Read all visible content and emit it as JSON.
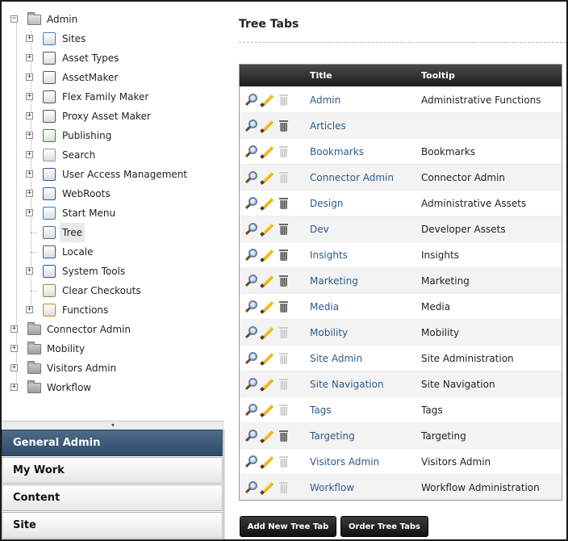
{
  "tree": {
    "root": {
      "label": "Admin",
      "expander": "−"
    },
    "children": [
      {
        "label": "Sites",
        "icon": "sites-icon",
        "expander": "+"
      },
      {
        "label": "Asset Types",
        "icon": "asset-types-icon",
        "expander": "+"
      },
      {
        "label": "AssetMaker",
        "icon": "assetmaker-icon",
        "expander": "+"
      },
      {
        "label": "Flex Family Maker",
        "icon": "flex-family-icon",
        "expander": "+"
      },
      {
        "label": "Proxy Asset Maker",
        "icon": "proxy-asset-icon",
        "expander": "+"
      },
      {
        "label": "Publishing",
        "icon": "publishing-icon",
        "expander": "+"
      },
      {
        "label": "Search",
        "icon": "search-folder-icon",
        "expander": "+"
      },
      {
        "label": "User Access Management",
        "icon": "tools-icon",
        "expander": "+"
      },
      {
        "label": "WebRoots",
        "icon": "tools-icon",
        "expander": "+"
      },
      {
        "label": "Start Menu",
        "icon": "start-menu-icon",
        "expander": "+"
      },
      {
        "label": "Tree",
        "icon": "tree-icon",
        "expander": ""
      },
      {
        "label": "Locale",
        "icon": "tools-icon",
        "expander": ""
      },
      {
        "label": "System Tools",
        "icon": "tools-icon",
        "expander": "+"
      },
      {
        "label": "Clear Checkouts",
        "icon": "checkout-icon",
        "expander": ""
      },
      {
        "label": "Functions",
        "icon": "functions-icon",
        "expander": "+"
      }
    ],
    "top_level": [
      {
        "label": "Connector Admin",
        "expander": "+"
      },
      {
        "label": "Mobility",
        "expander": "+"
      },
      {
        "label": "Visitors Admin",
        "expander": "+"
      },
      {
        "label": "Workflow",
        "expander": "+"
      }
    ]
  },
  "splitter_glyph": "▾",
  "accordion": [
    "General Admin",
    "My Work",
    "Content",
    "Site"
  ],
  "main": {
    "title": "Tree Tabs",
    "columns": {
      "title": "Title",
      "tooltip": "Tooltip"
    },
    "rows": [
      {
        "title": "Admin",
        "tooltip": "Administrative Functions",
        "deletable": false
      },
      {
        "title": "Articles",
        "tooltip": "",
        "deletable": true
      },
      {
        "title": "Bookmarks",
        "tooltip": "Bookmarks",
        "deletable": false
      },
      {
        "title": "Connector Admin",
        "tooltip": "Connector Admin",
        "deletable": false
      },
      {
        "title": "Design",
        "tooltip": "Administrative Assets",
        "deletable": true
      },
      {
        "title": "Dev",
        "tooltip": "Developer Assets",
        "deletable": true
      },
      {
        "title": "Insights",
        "tooltip": "Insights",
        "deletable": true
      },
      {
        "title": "Marketing",
        "tooltip": "Marketing",
        "deletable": true
      },
      {
        "title": "Media",
        "tooltip": "Media",
        "deletable": true
      },
      {
        "title": "Mobility",
        "tooltip": "Mobility",
        "deletable": false
      },
      {
        "title": "Site Admin",
        "tooltip": "Site Administration",
        "deletable": false
      },
      {
        "title": "Site Navigation",
        "tooltip": "Site Navigation",
        "deletable": false
      },
      {
        "title": "Tags",
        "tooltip": "Tags",
        "deletable": false
      },
      {
        "title": "Targeting",
        "tooltip": "Targeting",
        "deletable": true
      },
      {
        "title": "Visitors Admin",
        "tooltip": "Visitors Admin",
        "deletable": false
      },
      {
        "title": "Workflow",
        "tooltip": "Workflow Administration",
        "deletable": false
      }
    ],
    "buttons": {
      "add": "Add New Tree Tab",
      "order": "Order Tree Tabs"
    }
  }
}
